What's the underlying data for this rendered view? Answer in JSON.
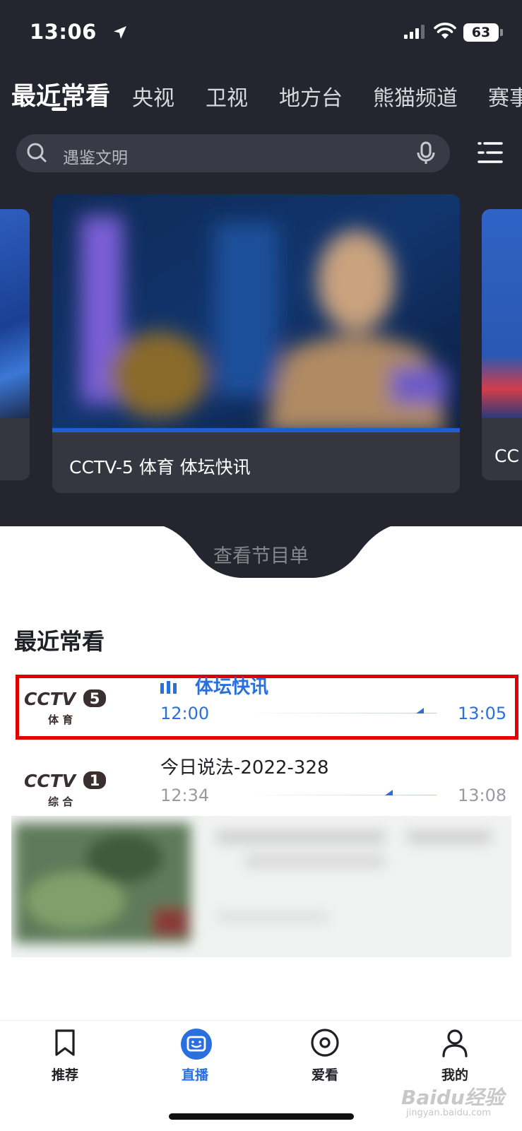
{
  "status_bar": {
    "time": "13:06",
    "battery": "63"
  },
  "tabs": [
    {
      "label": "最近常看",
      "active": true
    },
    {
      "label": "央视"
    },
    {
      "label": "卫视"
    },
    {
      "label": "地方台"
    },
    {
      "label": "熊猫频道"
    },
    {
      "label": "赛事"
    }
  ],
  "search": {
    "placeholder": "遇鉴文明"
  },
  "carousel": {
    "left_card_title": "",
    "main_card_title": "CCTV-5 体育 体坛快讯",
    "right_card_title": "CC"
  },
  "schedule_link": "查看节目单",
  "recent": {
    "title": "最近常看",
    "items": [
      {
        "logo_text": "CCTV",
        "logo_number": "5",
        "logo_subtitle": "体 育",
        "program": "体坛快讯",
        "start": "12:00",
        "end": "13:05",
        "progress": 0.97,
        "live": true
      },
      {
        "logo_text": "CCTV",
        "logo_number": "1",
        "logo_subtitle": "综 合",
        "program": "今日说法-2022-328",
        "start": "12:34",
        "end": "13:08",
        "progress": 0.94,
        "live": false
      }
    ]
  },
  "bottom_nav": [
    {
      "label": "推荐",
      "icon": "bookmark-icon"
    },
    {
      "label": "直播",
      "icon": "tv-face-icon",
      "active": true
    },
    {
      "label": "爱看",
      "icon": "disc-icon"
    },
    {
      "label": "我的",
      "icon": "person-icon"
    }
  ],
  "watermark": {
    "text": "Baidu经验",
    "sub": "jingyan.baidu.com"
  },
  "colors": {
    "accent": "#2a6fde",
    "dark_bg": "#252530",
    "highlight": "#e00000"
  }
}
